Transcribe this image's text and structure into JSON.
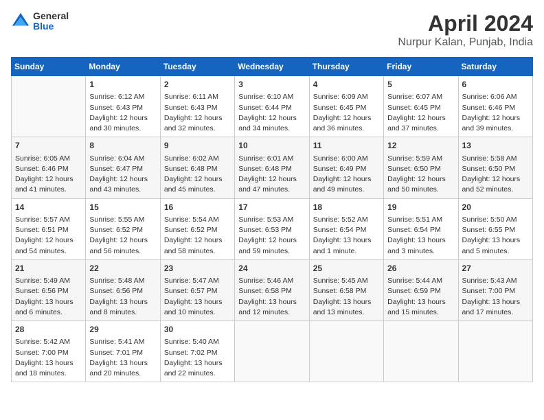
{
  "logo": {
    "general": "General",
    "blue": "Blue"
  },
  "title": "April 2024",
  "subtitle": "Nurpur Kalan, Punjab, India",
  "days_header": [
    "Sunday",
    "Monday",
    "Tuesday",
    "Wednesday",
    "Thursday",
    "Friday",
    "Saturday"
  ],
  "weeks": [
    [
      {
        "day": "",
        "info": ""
      },
      {
        "day": "1",
        "info": "Sunrise: 6:12 AM\nSunset: 6:43 PM\nDaylight: 12 hours\nand 30 minutes."
      },
      {
        "day": "2",
        "info": "Sunrise: 6:11 AM\nSunset: 6:43 PM\nDaylight: 12 hours\nand 32 minutes."
      },
      {
        "day": "3",
        "info": "Sunrise: 6:10 AM\nSunset: 6:44 PM\nDaylight: 12 hours\nand 34 minutes."
      },
      {
        "day": "4",
        "info": "Sunrise: 6:09 AM\nSunset: 6:45 PM\nDaylight: 12 hours\nand 36 minutes."
      },
      {
        "day": "5",
        "info": "Sunrise: 6:07 AM\nSunset: 6:45 PM\nDaylight: 12 hours\nand 37 minutes."
      },
      {
        "day": "6",
        "info": "Sunrise: 6:06 AM\nSunset: 6:46 PM\nDaylight: 12 hours\nand 39 minutes."
      }
    ],
    [
      {
        "day": "7",
        "info": "Sunrise: 6:05 AM\nSunset: 6:46 PM\nDaylight: 12 hours\nand 41 minutes."
      },
      {
        "day": "8",
        "info": "Sunrise: 6:04 AM\nSunset: 6:47 PM\nDaylight: 12 hours\nand 43 minutes."
      },
      {
        "day": "9",
        "info": "Sunrise: 6:02 AM\nSunset: 6:48 PM\nDaylight: 12 hours\nand 45 minutes."
      },
      {
        "day": "10",
        "info": "Sunrise: 6:01 AM\nSunset: 6:48 PM\nDaylight: 12 hours\nand 47 minutes."
      },
      {
        "day": "11",
        "info": "Sunrise: 6:00 AM\nSunset: 6:49 PM\nDaylight: 12 hours\nand 49 minutes."
      },
      {
        "day": "12",
        "info": "Sunrise: 5:59 AM\nSunset: 6:50 PM\nDaylight: 12 hours\nand 50 minutes."
      },
      {
        "day": "13",
        "info": "Sunrise: 5:58 AM\nSunset: 6:50 PM\nDaylight: 12 hours\nand 52 minutes."
      }
    ],
    [
      {
        "day": "14",
        "info": "Sunrise: 5:57 AM\nSunset: 6:51 PM\nDaylight: 12 hours\nand 54 minutes."
      },
      {
        "day": "15",
        "info": "Sunrise: 5:55 AM\nSunset: 6:52 PM\nDaylight: 12 hours\nand 56 minutes."
      },
      {
        "day": "16",
        "info": "Sunrise: 5:54 AM\nSunset: 6:52 PM\nDaylight: 12 hours\nand 58 minutes."
      },
      {
        "day": "17",
        "info": "Sunrise: 5:53 AM\nSunset: 6:53 PM\nDaylight: 12 hours\nand 59 minutes."
      },
      {
        "day": "18",
        "info": "Sunrise: 5:52 AM\nSunset: 6:54 PM\nDaylight: 13 hours\nand 1 minute."
      },
      {
        "day": "19",
        "info": "Sunrise: 5:51 AM\nSunset: 6:54 PM\nDaylight: 13 hours\nand 3 minutes."
      },
      {
        "day": "20",
        "info": "Sunrise: 5:50 AM\nSunset: 6:55 PM\nDaylight: 13 hours\nand 5 minutes."
      }
    ],
    [
      {
        "day": "21",
        "info": "Sunrise: 5:49 AM\nSunset: 6:56 PM\nDaylight: 13 hours\nand 6 minutes."
      },
      {
        "day": "22",
        "info": "Sunrise: 5:48 AM\nSunset: 6:56 PM\nDaylight: 13 hours\nand 8 minutes."
      },
      {
        "day": "23",
        "info": "Sunrise: 5:47 AM\nSunset: 6:57 PM\nDaylight: 13 hours\nand 10 minutes."
      },
      {
        "day": "24",
        "info": "Sunrise: 5:46 AM\nSunset: 6:58 PM\nDaylight: 13 hours\nand 12 minutes."
      },
      {
        "day": "25",
        "info": "Sunrise: 5:45 AM\nSunset: 6:58 PM\nDaylight: 13 hours\nand 13 minutes."
      },
      {
        "day": "26",
        "info": "Sunrise: 5:44 AM\nSunset: 6:59 PM\nDaylight: 13 hours\nand 15 minutes."
      },
      {
        "day": "27",
        "info": "Sunrise: 5:43 AM\nSunset: 7:00 PM\nDaylight: 13 hours\nand 17 minutes."
      }
    ],
    [
      {
        "day": "28",
        "info": "Sunrise: 5:42 AM\nSunset: 7:00 PM\nDaylight: 13 hours\nand 18 minutes."
      },
      {
        "day": "29",
        "info": "Sunrise: 5:41 AM\nSunset: 7:01 PM\nDaylight: 13 hours\nand 20 minutes."
      },
      {
        "day": "30",
        "info": "Sunrise: 5:40 AM\nSunset: 7:02 PM\nDaylight: 13 hours\nand 22 minutes."
      },
      {
        "day": "",
        "info": ""
      },
      {
        "day": "",
        "info": ""
      },
      {
        "day": "",
        "info": ""
      },
      {
        "day": "",
        "info": ""
      }
    ]
  ]
}
